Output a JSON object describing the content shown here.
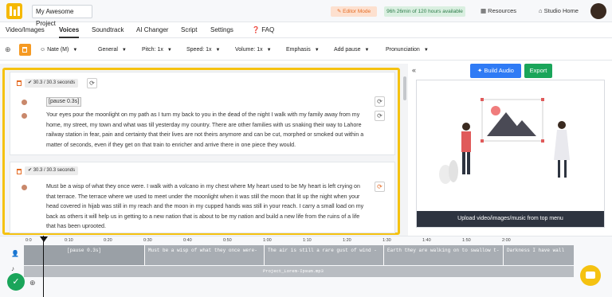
{
  "topbar": {
    "project_name": "My Awesome Project",
    "editor_mode": "Editor Mode",
    "availability": "96h 26min of 120 hours available",
    "resources": "Resources",
    "studio_home": "Studio Home"
  },
  "tabs": [
    {
      "label": "Video/Images"
    },
    {
      "label": "Voices"
    },
    {
      "label": "Soundtrack"
    },
    {
      "label": "AI Changer"
    },
    {
      "label": "Script"
    },
    {
      "label": "Settings"
    },
    {
      "label": "FAQ"
    }
  ],
  "toolbar": {
    "voice": "Nate (M)",
    "general": "General",
    "pitch": "Pitch: 1x",
    "speed": "Speed: 1x",
    "volume": "Volume: 1x",
    "emphasis": "Emphasis",
    "add_pause": "Add pause",
    "pronunciation": "Pronunciation"
  },
  "cards": [
    {
      "duration": "30.3 / 30.3 seconds",
      "pause_tag": "[pause 0.3s]",
      "text": "Your eyes pour the moonlight on my path as I turn my back to you in the dead of the night I walk with my family away from my home, my street, my town and what was till yesterday my country. There are other families with us snaking their way to Lahore railway station in fear, pain and certainty that their lives are not theirs anymore and can be cut, morphed or smoked out within a matter of seconds, even if they get on that train to enricher and arrive there in one piece they would."
    },
    {
      "duration": "30.3 / 30.3 seconds",
      "text": "Must be a wisp of what they once were. I walk with a volcano in my chest where My heart used to be My heart is left crying on that terrace. The terrace where we used to meet under the moonlight when it was still the moon that lit up the night when your head covered in hijab was still in my reach and the moon in my cupped hands was still in your reach. I carry a small load on my back as others it will help us in getting to a new nation that is about to be my nation and build a new life from the ruins of a life that has been uprooted."
    }
  ],
  "right_panel": {
    "build_audio": "Build Audio",
    "export": "Export",
    "upload_caption": "Upload video/images/music from top menu"
  },
  "timeline": {
    "ruler_labels": [
      "0:0",
      "0:10",
      "0:20",
      "0:30",
      "0:40",
      "0:50",
      "1:00",
      "1:10",
      "1:20",
      "1:30",
      "1:40",
      "1:50",
      "2:00"
    ],
    "segments": [
      "[pause 0.3s]",
      "Must be a wisp of what they once were-",
      "The air is still a rare gust of wind -",
      "Earth they are walking on to swallow t-",
      "Darkness I have wall"
    ],
    "music_file": "Project_Lorem-Ipsum.mp3"
  },
  "colors": {
    "accent_orange": "#f59a23",
    "highlight_yellow": "#f5c211",
    "build_blue": "#2f7bf5",
    "export_green": "#1aa55a"
  }
}
